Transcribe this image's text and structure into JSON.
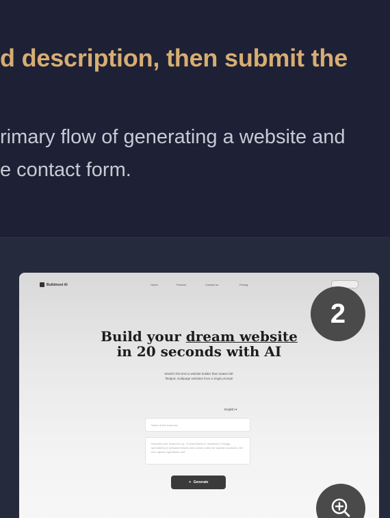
{
  "content": {
    "heading": "d description, then submit the",
    "paragraph_line1": "rimary flow of generating a website and",
    "paragraph_line2": "e contact form."
  },
  "preview": {
    "logo_text": "Buildmost AI",
    "nav": [
      "Home",
      "Product",
      "Contact us",
      "Pricing"
    ],
    "title_line1_pre": "Build your ",
    "title_line1_underlined": "dream website",
    "title_line2": "in 20 seconds with AI",
    "subtitle_line1": "World's first text to website builder that creates full-",
    "subtitle_line2": "fledged, multipage websites from a single prompt!",
    "language": "English",
    "name_placeholder": "Name of the business",
    "description_placeholder": "Describe your business e.g. 'A local bakery in downtown Chicago, specializing in artisanal breads and custom cakes for special occasions. We use organic ingredients and'",
    "generate_label": "Generate"
  },
  "overlay": {
    "step_number": "2",
    "zoom_icon": "zoom-in-icon"
  },
  "colors": {
    "background": "#1e2135",
    "heading": "#d7ad72",
    "paragraph": "#c8cad6",
    "badge": "#4a4a4a"
  }
}
